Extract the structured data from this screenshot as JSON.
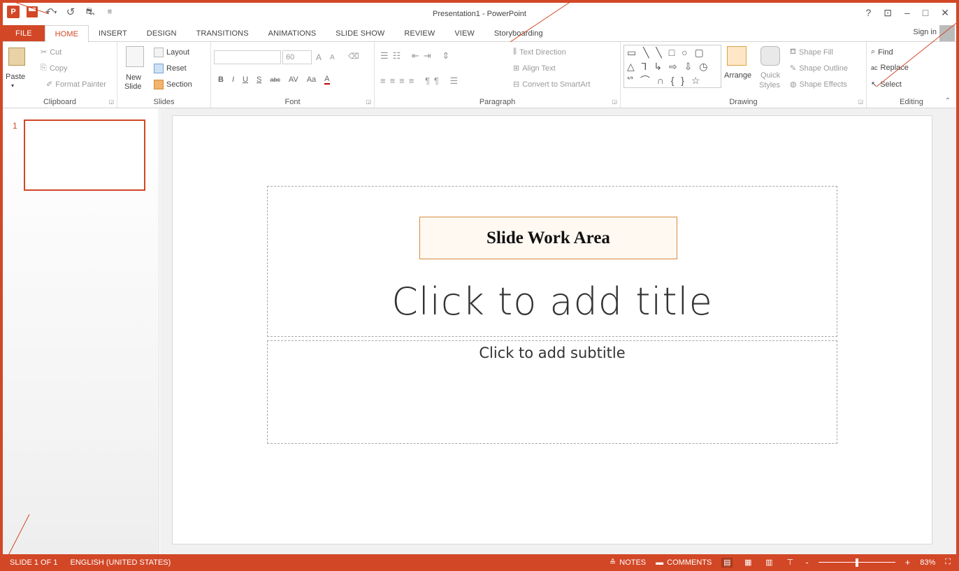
{
  "window": {
    "title": "Presentation1 - PowerPoint",
    "controls": {
      "help": "?",
      "ribbon_options": "⊡",
      "minimize": "–",
      "maximize": "□",
      "close": "✕"
    }
  },
  "qat": {
    "app_logo": "P",
    "undo": "↶",
    "undo_dd": "▾",
    "redo": "↺",
    "touch_mode": "⛐",
    "customize": "≡"
  },
  "tabs": [
    {
      "label": "FILE"
    },
    {
      "label": "HOME"
    },
    {
      "label": "INSERT"
    },
    {
      "label": "DESIGN"
    },
    {
      "label": "TRANSITIONS"
    },
    {
      "label": "ANIMATIONS"
    },
    {
      "label": "SLIDE SHOW"
    },
    {
      "label": "REVIEW"
    },
    {
      "label": "VIEW"
    },
    {
      "label": "Storyboarding"
    }
  ],
  "signin": "Sign in",
  "ribbon": {
    "clipboard": {
      "label": "Clipboard",
      "paste": "Paste",
      "cut": "Cut",
      "copy": "Copy",
      "format_painter": "Format Painter"
    },
    "slides": {
      "label": "Slides",
      "new_slide_1": "New",
      "new_slide_2": "Slide",
      "layout": "Layout",
      "reset": "Reset",
      "section": "Section"
    },
    "font": {
      "label": "Font",
      "font_name": "",
      "font_size": "60",
      "bold": "B",
      "italic": "I",
      "underline": "U",
      "shadow": "S",
      "strike": "abc",
      "spacing": "AV",
      "case": "Aa",
      "color": "A",
      "grow": "A",
      "shrink": "A"
    },
    "paragraph": {
      "label": "Paragraph",
      "text_direction": "Text Direction",
      "align_text": "Align Text",
      "convert_smartart": "Convert to SmartArt"
    },
    "drawing": {
      "label": "Drawing",
      "arrange": "Arrange",
      "quick_styles_1": "Quick",
      "quick_styles_2": "Styles",
      "shape_fill": "Shape Fill",
      "shape_outline": "Shape Outline",
      "shape_effects": "Shape Effects",
      "shapes_row1": "▭ ╲ ╲ □ ○ ▢",
      "shapes_row2": "△ ⅂ ↳ ⇨ ⇩ ◷",
      "shapes_row3": "ᔥ ⌒ ∩ { } ☆"
    },
    "editing": {
      "label": "Editing",
      "find": "Find",
      "replace": "Replace",
      "select": "Select"
    }
  },
  "thumbnails": [
    {
      "number": "1"
    }
  ],
  "slide": {
    "title_placeholder": "Click to add title",
    "subtitle_placeholder": "Click to add subtitle"
  },
  "callout": {
    "text": "Slide Work Area"
  },
  "statusbar": {
    "slide_info": "SLIDE 1 OF 1",
    "language": "ENGLISH (UNITED STATES)",
    "notes": "NOTES",
    "comments": "COMMENTS",
    "zoom_minus": "-",
    "zoom_plus": "+",
    "zoom": "83%",
    "zoom_fraction": 0.5
  }
}
